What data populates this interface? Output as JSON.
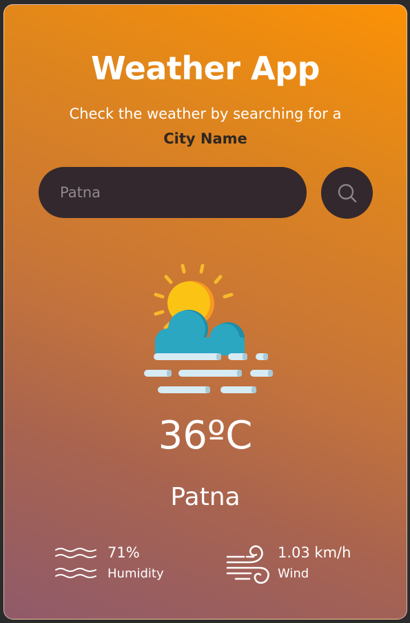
{
  "app": {
    "title": "Weather App",
    "subtitle": "Check the weather by searching for a",
    "subtitle_bold": "City Name"
  },
  "search": {
    "value": "Patna",
    "button_icon": "search-icon"
  },
  "weather": {
    "icon": "sun-cloud-fog-icon",
    "temperature": "36ºC",
    "city": "Patna"
  },
  "stats": {
    "humidity": {
      "value": "71%",
      "label": "Humidity",
      "icon": "humidity-waves-icon"
    },
    "wind": {
      "value": "1.03 km/h",
      "label": "Wind",
      "icon": "wind-icon"
    }
  },
  "colors": {
    "gradient_top": "#fb9105",
    "gradient_bottom": "#8f5a6a",
    "input_background": "#33282d",
    "accent_dark_text": "#2e2622"
  }
}
